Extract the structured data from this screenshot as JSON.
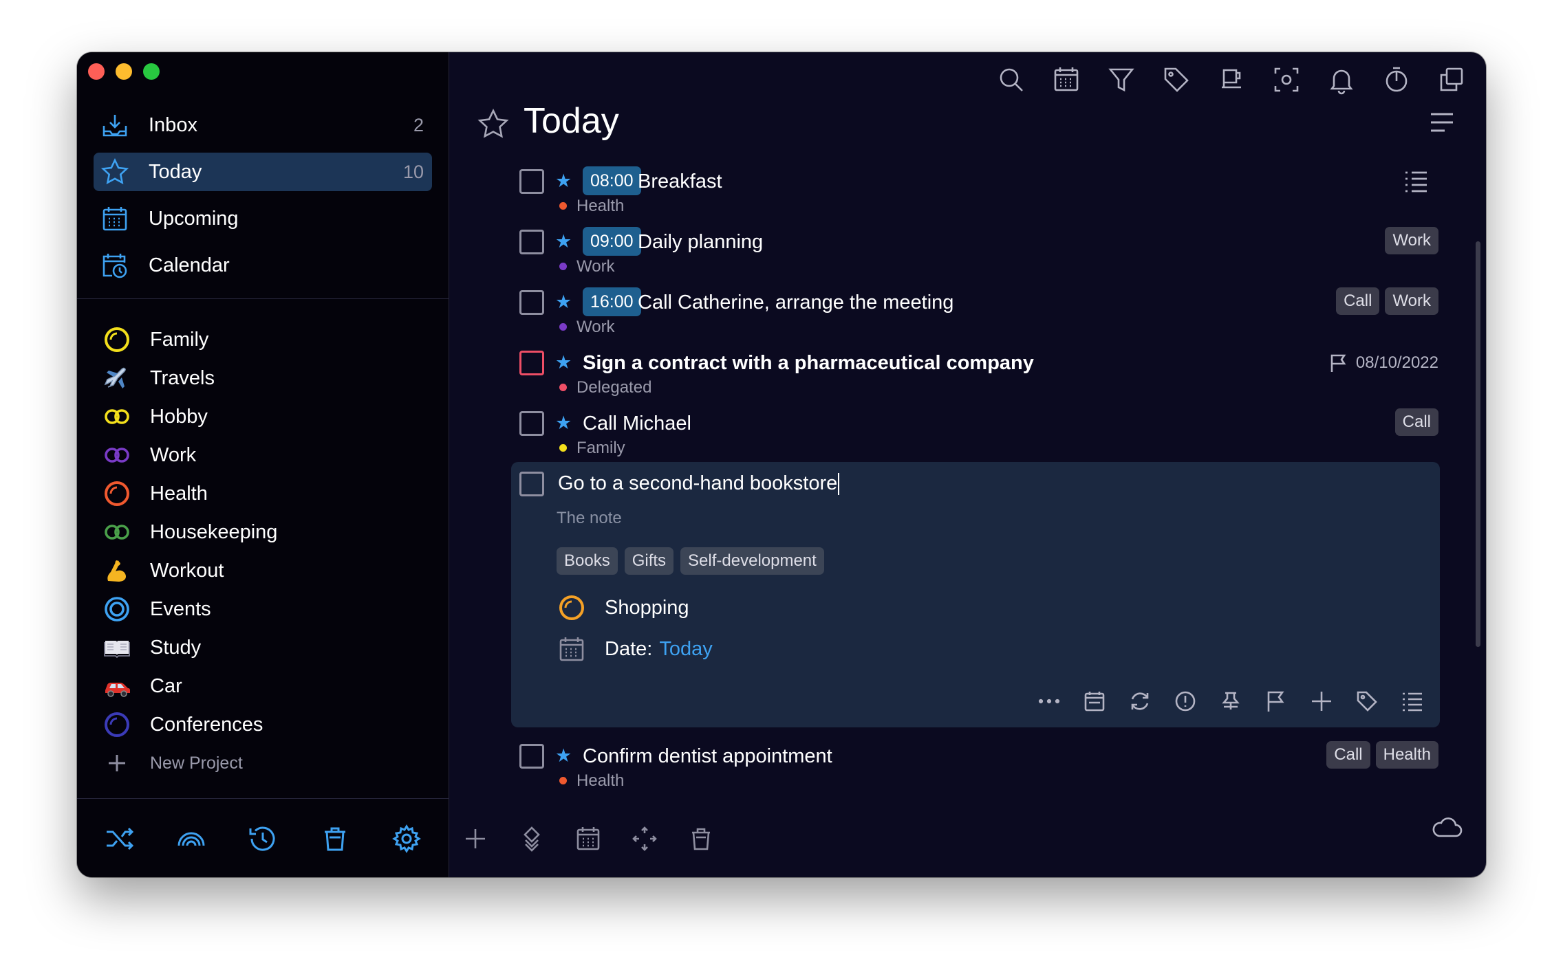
{
  "sidebar": {
    "nav": [
      {
        "label": "Inbox",
        "count": "2",
        "icon": "inbox-icon"
      },
      {
        "label": "Today",
        "count": "10",
        "icon": "star-icon"
      },
      {
        "label": "Upcoming",
        "count": "",
        "icon": "calendar-grid-icon"
      },
      {
        "label": "Calendar",
        "count": "",
        "icon": "calendar-clock-icon"
      }
    ],
    "projects": [
      {
        "label": "Family",
        "icon": "ring-yellow-icon",
        "color": "#f3df1c"
      },
      {
        "label": "Travels",
        "icon": "airplane-icon",
        "color": "#9fb7d4"
      },
      {
        "label": "Hobby",
        "icon": "double-ring-icon",
        "color": "#f3df1c"
      },
      {
        "label": "Work",
        "icon": "double-ring-icon",
        "color": "#7a3bc7"
      },
      {
        "label": "Health",
        "icon": "ring-red-icon",
        "color": "#f0592f"
      },
      {
        "label": "Housekeeping",
        "icon": "double-ring-icon",
        "color": "#4aa04a"
      },
      {
        "label": "Workout",
        "icon": "flexed-arm-icon",
        "color": "#f5b521"
      },
      {
        "label": "Events",
        "icon": "target-ring-icon",
        "color": "#3ea2f2"
      },
      {
        "label": "Study",
        "icon": "book-icon",
        "color": "#e6e6ee"
      },
      {
        "label": "Car",
        "icon": "car-icon",
        "color": "#e0322b"
      },
      {
        "label": "Conferences",
        "icon": "ring-indigo-icon",
        "color": "#3b3bb8"
      }
    ],
    "new_project": "New Project"
  },
  "main": {
    "title": "Today",
    "tasks": [
      {
        "time": "08:00",
        "title": "Breakfast",
        "project": "Health",
        "dot": "#f0592f",
        "tags": []
      },
      {
        "time": "09:00",
        "title": "Daily planning",
        "project": "Work",
        "dot": "#7a3bc7",
        "tags": [
          "Work"
        ]
      },
      {
        "time": "16:00",
        "title": "Call Catherine, arrange the meeting",
        "project": "Work",
        "dot": "#7a3bc7",
        "tags": [
          "Call",
          "Work"
        ]
      },
      {
        "time": "",
        "title": "Sign a contract with a pharmaceutical company",
        "project": "Delegated",
        "dot": "#ee4e66",
        "due": "08/10/2022"
      },
      {
        "time": "",
        "title": "Call Michael",
        "project": "Family",
        "dot": "#f3df1c",
        "tags": [
          "Call"
        ]
      },
      {
        "time": "",
        "title": "Confirm dentist appointment",
        "project": "Health",
        "dot": "#f0592f",
        "tags": [
          "Call",
          "Health"
        ]
      }
    ],
    "editor": {
      "title": "Go to a second-hand bookstore",
      "note": "The note",
      "tags": [
        "Books",
        "Gifts",
        "Self-development"
      ],
      "project": "Shopping",
      "date_label": "Date:",
      "date_value": "Today"
    }
  },
  "colors": {
    "accent": "#3ea2f2",
    "selected_nav": "#1c3556",
    "time_badge": "#1e5f8f",
    "editor_bg": "#1b2840"
  }
}
